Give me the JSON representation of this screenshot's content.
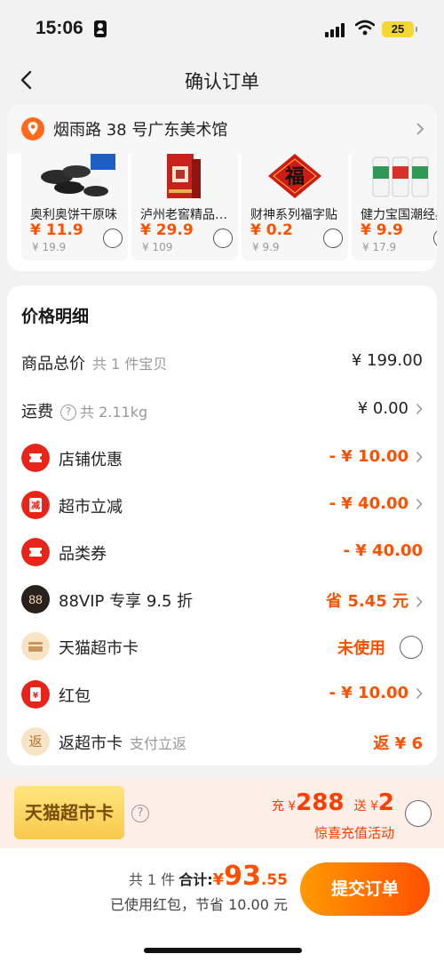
{
  "status": {
    "time": "15:06",
    "battery": "25"
  },
  "nav": {
    "title": "确认订单"
  },
  "address": {
    "text": "烟雨路 38 号广东美术馆"
  },
  "products": [
    {
      "name": "奥利奥饼干原味",
      "price": "¥ 11.9",
      "orig": "¥ 19.9"
    },
    {
      "name": "泸州老窖精品头曲",
      "price": "¥ 29.9",
      "orig": "¥ 109"
    },
    {
      "name": "财神系列福字贴",
      "price": "¥ 0.2",
      "orig": "¥ 9.9"
    },
    {
      "name": "健力宝国潮经典",
      "price": "¥ 9.9",
      "orig": "¥ 17.9"
    }
  ],
  "detail": {
    "title": "价格明细",
    "goods_total": {
      "label": "商品总价",
      "sub": "共 1 件宝贝",
      "value": "¥ 199.00"
    },
    "shipping": {
      "label": "运费",
      "sub": "共 2.11kg",
      "value": "¥ 0.00"
    },
    "shop_discount": {
      "label": "店铺优惠",
      "value": "- ¥ 10.00"
    },
    "market_discount": {
      "label": "超市立减",
      "value": "- ¥ 40.00"
    },
    "category_coupon": {
      "label": "品类券",
      "value": "- ¥ 40.00"
    },
    "vip": {
      "label": "88VIP 专享 9.5 折",
      "value": "省 5.45 元",
      "icon_text": "88"
    },
    "tmall_card": {
      "label": "天猫超市卡",
      "value": "未使用"
    },
    "red_packet": {
      "label": "红包",
      "value": "- ¥ 10.00"
    },
    "rebate": {
      "label": "返超市卡",
      "sub": "支付立返",
      "value": "返 ¥ 6",
      "icon_text": "返"
    }
  },
  "promo": {
    "badge": "天猫超市卡",
    "charge_prefix": "充 ¥",
    "charge_amount": "288",
    "gift_prefix": "送 ¥",
    "gift_amount": "2",
    "sub": "惊喜充值活动"
  },
  "bottom": {
    "count": "共 1 件",
    "total_label": "合计:",
    "currency": "¥",
    "total_int": "93",
    "total_dec": ".55",
    "saved": "已使用红包，节省 10.00 元",
    "submit": "提交订单"
  },
  "colors": {
    "accent": "#ff5000",
    "coupon_red": "#e8231a",
    "promo_bg": "#fdeee8"
  }
}
